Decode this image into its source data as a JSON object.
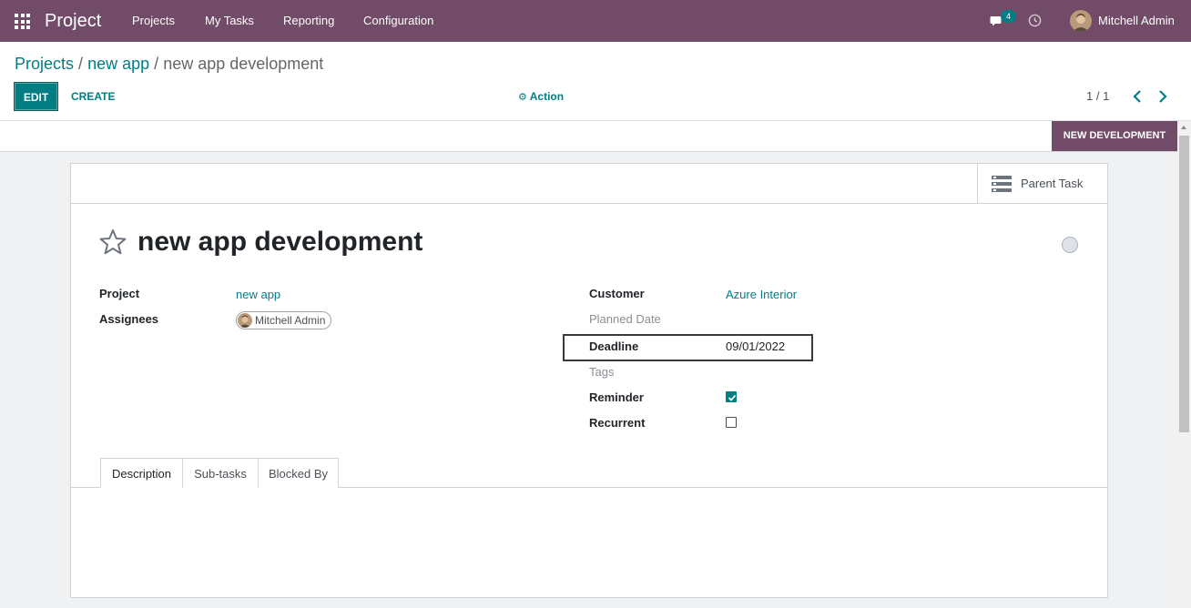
{
  "navbar": {
    "app_title": "Project",
    "menu": [
      "Projects",
      "My Tasks",
      "Reporting",
      "Configuration"
    ],
    "messages_count": "4",
    "user_name": "Mitchell Admin",
    "icons": [
      "apps-grid-icon",
      "chat-icon",
      "clock-icon"
    ]
  },
  "breadcrumb": {
    "items": [
      "Projects",
      "new app"
    ],
    "separator": "/",
    "current": "new app development"
  },
  "control_panel": {
    "edit_label": "EDIT",
    "create_label": "CREATE",
    "action_label": "Action",
    "pager_value": "1 / 1"
  },
  "statusbar": {
    "stage_label": "NEW DEVELOPMENT"
  },
  "button_box": {
    "parent_task_label": "Parent Task"
  },
  "task": {
    "title": "new app development",
    "starred": false,
    "kanban_state_color": "#dee2e6"
  },
  "fields": {
    "project_label": "Project",
    "project_value": "new app",
    "assignees_label": "Assignees",
    "assignee_name": "Mitchell Admin",
    "customer_label": "Customer",
    "customer_value": "Azure Interior",
    "planned_date_label": "Planned Date",
    "deadline_label": "Deadline",
    "deadline_value": "09/01/2022",
    "tags_label": "Tags",
    "reminder_label": "Reminder",
    "reminder_checked": true,
    "recurrent_label": "Recurrent",
    "recurrent_checked": false
  },
  "tabs": [
    "Description",
    "Sub-tasks",
    "Blocked By"
  ],
  "active_tab": "Description",
  "colors": {
    "brand": "#714b67",
    "accent": "#017e84"
  }
}
